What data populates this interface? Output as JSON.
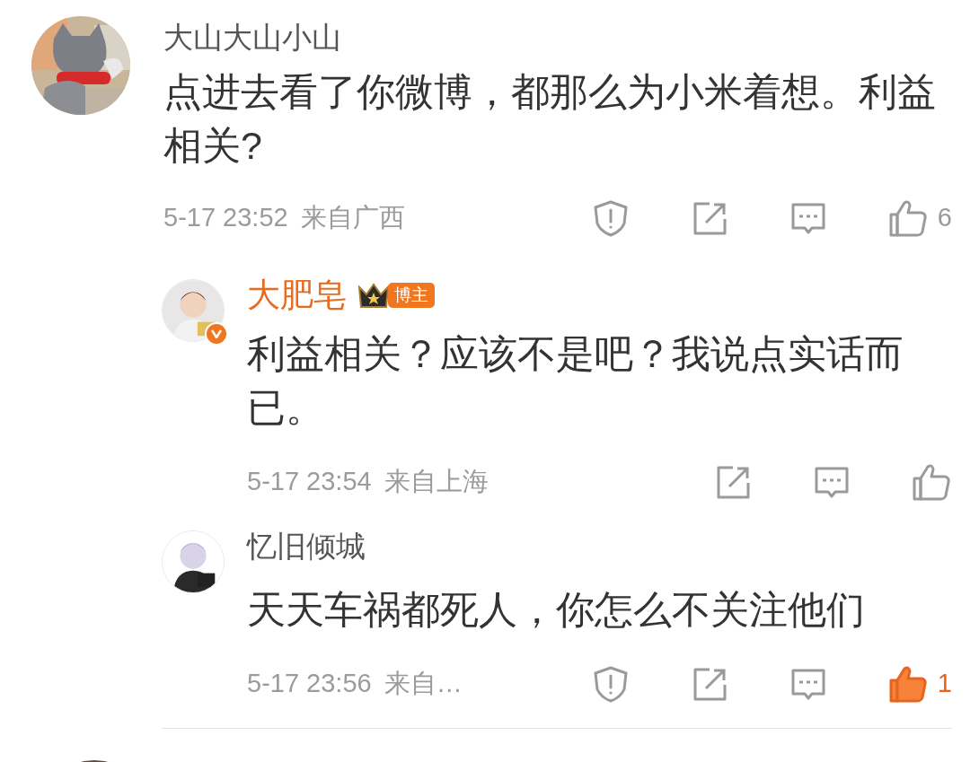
{
  "comments": [
    {
      "kind": "main",
      "author": "大山大山小山",
      "vip": false,
      "text": "点进去看了你微博，都那么为小米着想。利益相关?",
      "time": "5-17 23:52",
      "location": "来自广西",
      "actions": [
        {
          "kind": "report"
        },
        {
          "kind": "share"
        },
        {
          "kind": "comment"
        },
        {
          "kind": "like",
          "selected": false,
          "count": "6"
        }
      ],
      "replies": [
        {
          "kind": "reply",
          "author": "大肥皂",
          "vip": true,
          "verified": true,
          "crown_badge": true,
          "badge": "博主",
          "text": "利益相关？应该不是吧？我说点实话而已。",
          "time": "5-17 23:54",
          "location": "来自上海",
          "actions": [
            {
              "kind": "share"
            },
            {
              "kind": "comment"
            },
            {
              "kind": "like",
              "selected": false
            }
          ]
        },
        {
          "kind": "reply",
          "author": "忆旧倾城",
          "vip": false,
          "verified": false,
          "crown_badge": false,
          "text": "天天车祸都死人，你怎么不关注他们",
          "time": "5-17 23:56",
          "location": "来自…",
          "actions": [
            {
              "kind": "report"
            },
            {
              "kind": "share"
            },
            {
              "kind": "comment"
            },
            {
              "kind": "like",
              "selected": true,
              "count": "1"
            }
          ]
        }
      ]
    }
  ]
}
